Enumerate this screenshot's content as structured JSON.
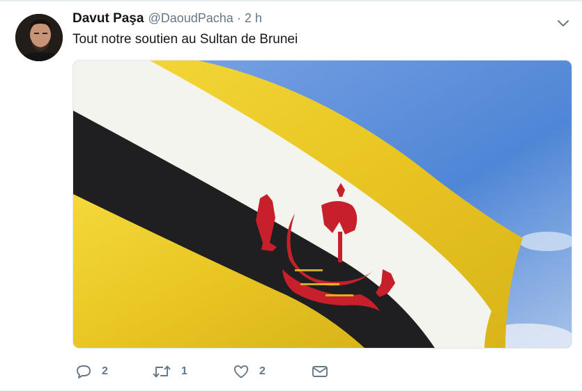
{
  "tweet": {
    "author_name": "Davut Paşa",
    "author_handle": "@DaoudPacha",
    "separator": "·",
    "timestamp": "2 h",
    "text": "Tout notre soutien au Sultan de Brunei"
  },
  "actions": {
    "replies": "2",
    "retweets": "1",
    "likes": "2"
  },
  "icons": {
    "more": "chevron-down-icon",
    "reply": "reply-icon",
    "retweet": "retweet-icon",
    "like": "heart-icon",
    "message": "direct-message-icon"
  },
  "colors": {
    "text_primary": "#14171a",
    "text_secondary": "#657786",
    "divider": "#e6ecf0",
    "flag_yellow": "#f2d22e",
    "flag_white": "#f5f5f0",
    "flag_black": "#1c1c1e",
    "flag_crest_red": "#c8202b",
    "sky_blue": "#5b8fd9"
  }
}
